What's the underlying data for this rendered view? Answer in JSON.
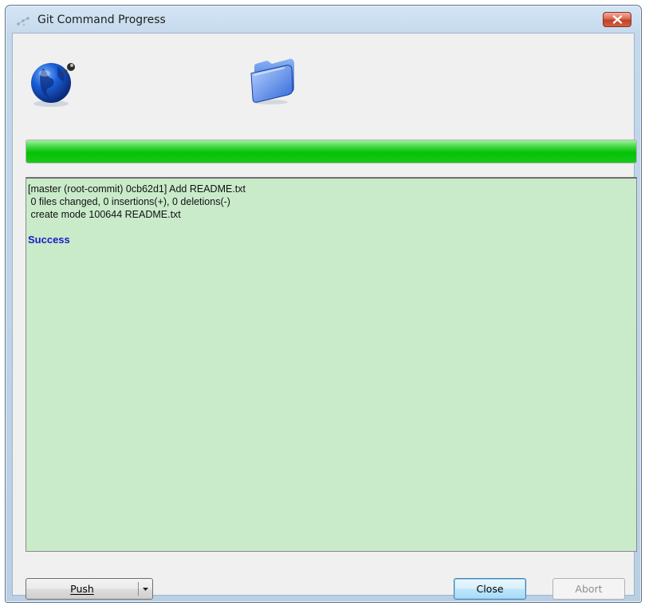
{
  "window": {
    "title": "Git Command Progress"
  },
  "icons": {
    "title_icon": "git-app-icon",
    "left_icon": "globe-remote-icon",
    "right_icon": "folder-icon",
    "close_icon": "close-icon",
    "dropdown_icon": "chevron-down-icon"
  },
  "progress": {
    "value": 1.0,
    "color": "#0bbf0b"
  },
  "log": {
    "lines": [
      "[master (root-commit) 0cb62d1] Add README.txt",
      " 0 files changed, 0 insertions(+), 0 deletions(-)",
      " create mode 100644 README.txt"
    ],
    "status": "Success",
    "background": "#c9ebca",
    "status_color": "#1a1ac8"
  },
  "buttons": {
    "push_label": "Push",
    "close_label": "Close",
    "abort_label": "Abort"
  }
}
